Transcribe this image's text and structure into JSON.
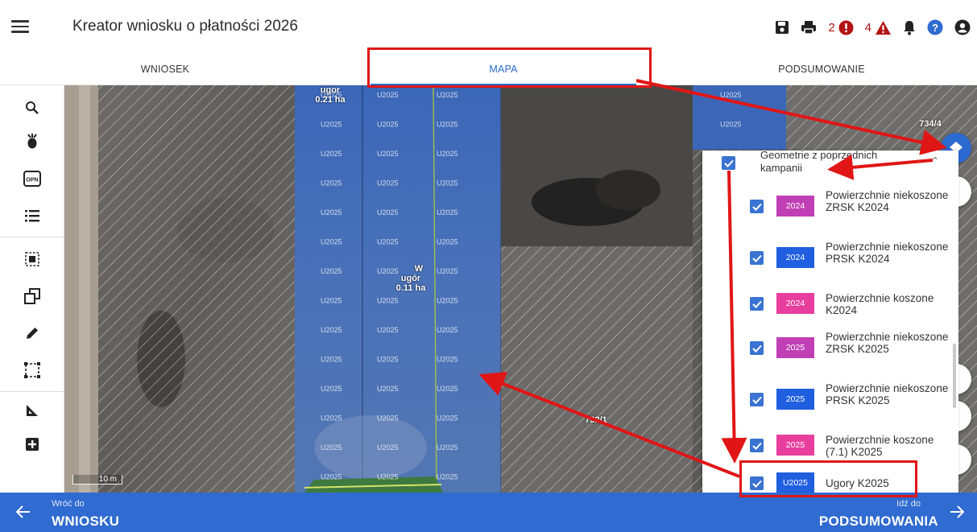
{
  "header": {
    "title": "Kreator wniosku o płatności 2026",
    "errors_count": "2",
    "warnings_count": "4"
  },
  "tabs": [
    {
      "label": "WNIOSEK"
    },
    {
      "label": "MAPA",
      "active": true
    },
    {
      "label": "PODSUMOWANIE"
    }
  ],
  "left_toolbar": {
    "opn_label": "OPN"
  },
  "map": {
    "parcel_labels": {
      "top_left": [
        "ugor",
        "0.21 ha"
      ],
      "center": [
        "W",
        "ugór",
        "0.11 ha"
      ],
      "right_id": "734/4",
      "lower_id": "732/1"
    },
    "stripe_label": "U2025",
    "scale_label": "10 m"
  },
  "layer_panel": {
    "group_label": "Geometrie z poprzednich kampanii",
    "items": [
      {
        "badge": "2024",
        "badge_color": "#c13fb4",
        "label": "Powierzchnie niekoszone ZRSK K2024"
      },
      {
        "badge": "2024",
        "badge_color": "#1f5fe0",
        "label": "Powierzchnie niekoszone PRSK K2024"
      },
      {
        "badge": "2024",
        "badge_color": "#e83f9e",
        "label": "Powierzchnie koszone K2024"
      },
      {
        "badge": "2025",
        "badge_color": "#c13fb4",
        "label": "Powierzchnie niekoszone ZRSK K2025"
      },
      {
        "badge": "2025",
        "badge_color": "#1f5fe0",
        "label": "Powierzchnie niekoszone PRSK K2025"
      },
      {
        "badge": "2025",
        "badge_color": "#e83f9e",
        "label": "Powierzchnie koszone (7.1) K2025"
      },
      {
        "badge": "U2025",
        "badge_color": "#1f5fe0",
        "label": "Ugory K2025"
      }
    ]
  },
  "bottom_bar": {
    "back_small": "Wróć do",
    "back_big": "WNIOSKU",
    "fwd_small": "Idź do",
    "fwd_big": "PODSUMOWANIA"
  },
  "colors": {
    "primary": "#2f6bd0",
    "annotation": "#e01616",
    "error": "#b31414"
  }
}
